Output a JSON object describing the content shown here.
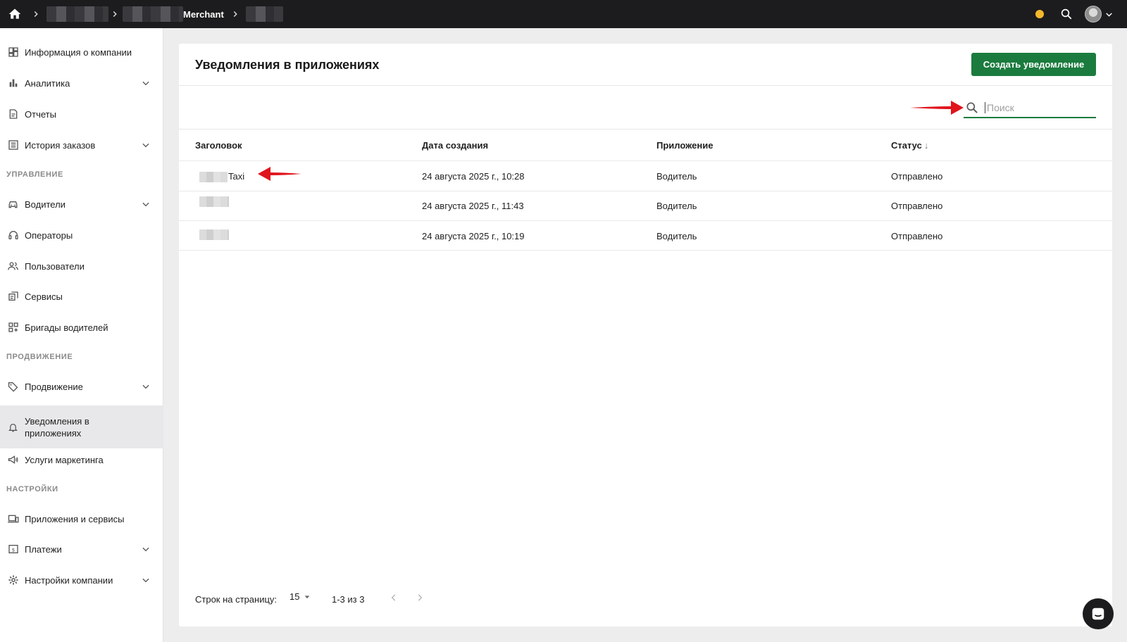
{
  "topbar": {
    "breadcrumb_merchant": "Merchant",
    "status_color": "#f2b92c",
    "icons": [
      "home-icon",
      "chevron-right-icon",
      "search-icon",
      "avatar",
      "chevron-down-icon"
    ]
  },
  "sidebar": {
    "items": [
      {
        "label": "Информация о компании",
        "icon": "dashboard-icon"
      },
      {
        "label": "Аналитика",
        "icon": "bar-chart-icon",
        "expandable": true
      },
      {
        "label": "Отчеты",
        "icon": "report-icon"
      },
      {
        "label": "История заказов",
        "icon": "list-icon",
        "expandable": true
      },
      {
        "label": "Водители",
        "icon": "car-icon",
        "expandable": true
      },
      {
        "label": "Операторы",
        "icon": "headset-icon"
      },
      {
        "label": "Пользователи",
        "icon": "users-icon"
      },
      {
        "label": "Сервисы",
        "icon": "services-icon"
      },
      {
        "label": "Бригады водителей",
        "icon": "grid-plus-icon"
      },
      {
        "label": "Продвижение",
        "icon": "tag-icon",
        "expandable": true
      },
      {
        "label": "Уведомления в приложениях",
        "icon": "bell-icon",
        "active": true
      },
      {
        "label": "Услуги маркетинга",
        "icon": "megaphone-icon"
      },
      {
        "label": "Приложения и сервисы",
        "icon": "devices-icon"
      },
      {
        "label": "Платежи",
        "icon": "payment-icon",
        "expandable": true
      },
      {
        "label": "Настройки компании",
        "icon": "gear-icon",
        "expandable": true
      }
    ],
    "sections": [
      "УПРАВЛЕНИЕ",
      "ПРОДВИЖЕНИЕ",
      "НАСТРОЙКИ"
    ]
  },
  "main": {
    "title": "Уведомления в приложениях",
    "create_button": "Создать уведомление",
    "search_placeholder": "Поиск",
    "columns": [
      "Заголовок",
      "Дата создания",
      "Приложение",
      "Статус"
    ],
    "sort_indicator": "↓",
    "rows": [
      {
        "title": "Taxi",
        "date": "24 августа 2025 г., 10:28",
        "app": "Водитель",
        "status": "Отправлено"
      },
      {
        "title": "",
        "date": "24 августа 2025 г., 11:43",
        "app": "Водитель",
        "status": "Отправлено"
      },
      {
        "title": "",
        "date": "24 августа 2025 г., 10:19",
        "app": "Водитель",
        "status": "Отправлено"
      }
    ],
    "footer": {
      "rows_per_page_label": "Строк на страницу:",
      "rows_per_page_value": "15",
      "range": "1-3 из 3"
    }
  },
  "colors": {
    "accent": "#1b7b3e",
    "annotation_arrow": "#e0141c"
  }
}
